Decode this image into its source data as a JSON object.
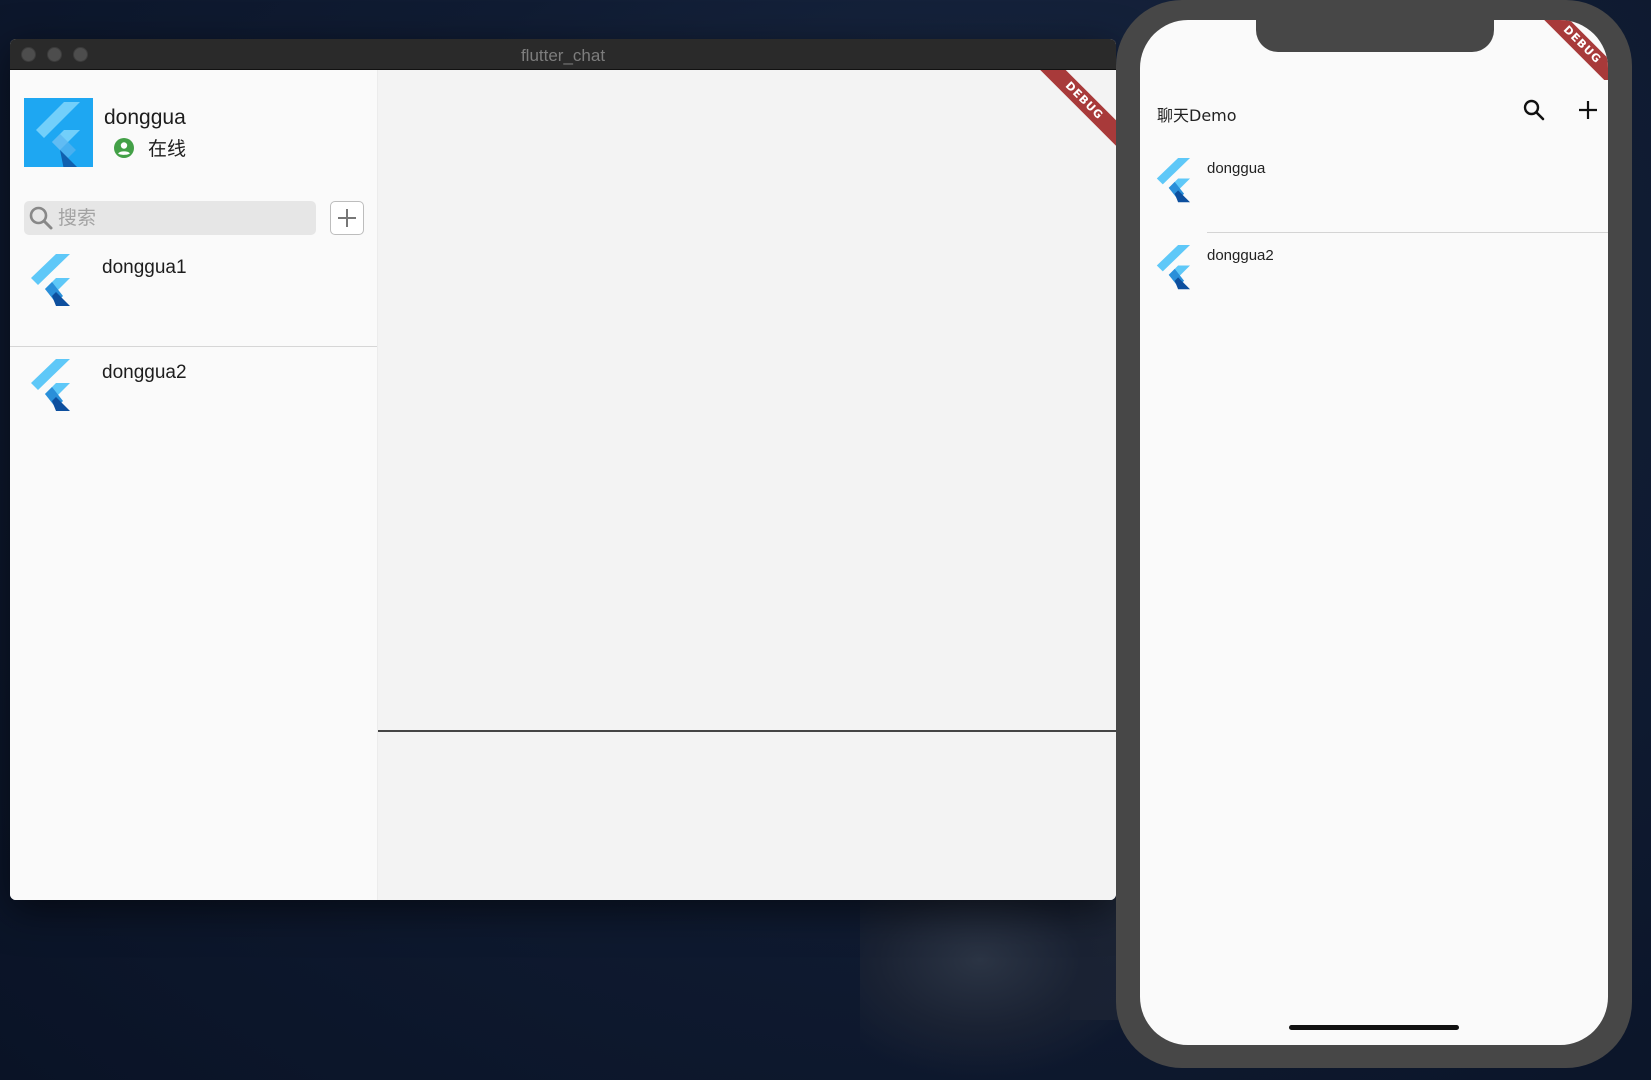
{
  "desktop_window": {
    "title": "flutter_chat",
    "debug_banner": "DEBUG",
    "profile": {
      "name": "donggua",
      "status": "在线"
    },
    "search": {
      "placeholder": "搜索"
    },
    "contacts": [
      {
        "name": "donggua1"
      },
      {
        "name": "donggua2"
      }
    ]
  },
  "phone": {
    "debug_banner": "DEBUG",
    "appbar": {
      "title": "聊天Demo"
    },
    "contacts": [
      {
        "name": "donggua"
      },
      {
        "name": "donggua2"
      }
    ]
  },
  "colors": {
    "flutter_light": "#5ec8f8",
    "flutter_dark": "#0d4f9e",
    "status_online": "#43a047",
    "debug_red": "#a83a3a"
  }
}
